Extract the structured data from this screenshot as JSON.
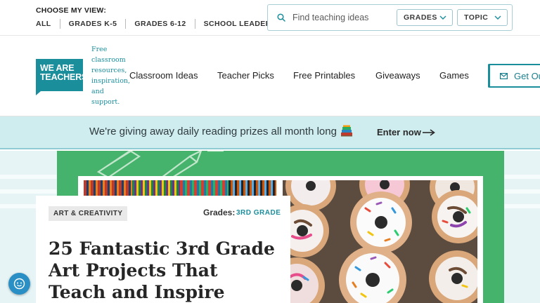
{
  "utility": {
    "choose_label": "CHOOSE MY VIEW:",
    "grade_links": [
      "ALL",
      "GRADES K-5",
      "GRADES 6-12",
      "SCHOOL LEADERS"
    ]
  },
  "search": {
    "placeholder": "Find teaching ideas",
    "grades_label": "GRADES",
    "topic_label": "TOPIC"
  },
  "header": {
    "logo_line1": "WE ARE",
    "logo_line2": "TEACHERS",
    "tagline": "Free classroom resources, inspiration, and support.",
    "nav": [
      "Classroom Ideas",
      "Teacher Picks",
      "Free Printables",
      "Giveaways",
      "Games"
    ],
    "cta_label": "Get Our Newsletter"
  },
  "promo": {
    "text": "We're giving away daily reading prizes all month long",
    "icon": "books-icon",
    "link_label": "Enter now"
  },
  "article": {
    "category": "ART & CREATIVITY",
    "grades_label": "Grades:",
    "grade_value": "3RD GRADE",
    "title": "25 Fantastic 3rd Grade Art Projects That Teach and Inspire"
  },
  "colors": {
    "brand": "#1b8e9c",
    "promo_bg": "#cfecef",
    "hero_green": "#45b36b"
  }
}
